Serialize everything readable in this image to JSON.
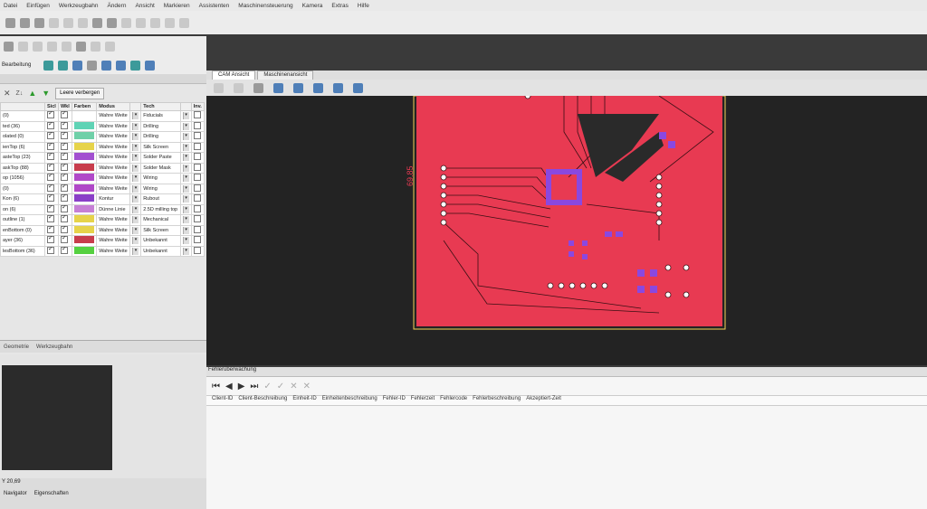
{
  "menu": [
    "Datei",
    "Einfügen",
    "Werkzeugbahn",
    "Ändern",
    "Ansicht",
    "Markieren",
    "Assistenten",
    "Maschinensteuerung",
    "Kamera",
    "Extras",
    "Hilfe"
  ],
  "toolbar": {
    "label_bearbeitung": "Bearbeitung"
  },
  "layers_panel": {
    "hide_button": "Leere verbergen",
    "columns": [
      "",
      "Sicl",
      "Wkl",
      "Farben",
      "Modus",
      "",
      "Tech",
      "",
      "Inv."
    ],
    "rows": [
      {
        "name": "(0)",
        "color": "#ffffff",
        "mode": "Wahre Weite",
        "tech": "Fiducials"
      },
      {
        "name": "ted (36)",
        "color": "#5fd3b5",
        "mode": "Wahre Weite",
        "tech": "Drilling"
      },
      {
        "name": "olated (0)",
        "color": "#6fd0a8",
        "mode": "Wahre Weite",
        "tech": "Drilling"
      },
      {
        "name": "ienTop (6)",
        "color": "#e6d34a",
        "mode": "Wahre Weite",
        "tech": "Silk Screen"
      },
      {
        "name": "asteTop (23)",
        "color": "#a24fd0",
        "mode": "Wahre Weite",
        "tech": "Solder Paste"
      },
      {
        "name": "askTop (88)",
        "color": "#c83c4c",
        "mode": "Wahre Weite",
        "tech": "Solder Mask"
      },
      {
        "name": "op (1056)",
        "color": "#b048c8",
        "mode": "Wahre Weite",
        "tech": "Wiring"
      },
      {
        "name": "(0)",
        "color": "#b048c8",
        "mode": "Wahre Weite",
        "tech": "Wiring"
      },
      {
        "name": "Kon (6)",
        "color": "#8a3fc8",
        "mode": "Kontur",
        "tech": "Rubout"
      },
      {
        "name": "on (6)",
        "color": "#c67fd6",
        "mode": "Dünne Linie",
        "tech": "2.5D milling top"
      },
      {
        "name": "outline (1)",
        "color": "#e6d34a",
        "mode": "Wahre Weite",
        "tech": "Mechanical"
      },
      {
        "name": "enBottom (0)",
        "color": "#e6d34a",
        "mode": "Wahre Weite",
        "tech": "Silk Screen"
      },
      {
        "name": "ayer (36)",
        "color": "#c83c4c",
        "mode": "Wahre Weite",
        "tech": "Unbekannt"
      },
      {
        "name": "lesBottom (36)",
        "color": "#55d040",
        "mode": "Wahre Weite",
        "tech": "Unbekannt"
      }
    ]
  },
  "bottom_tabs": [
    "Geometrie",
    "Werkzeugbahn"
  ],
  "status_left": {
    "coord": "Y 20,69",
    "tab1": "Navigator",
    "tab2": "Eigenschaften"
  },
  "cam": {
    "tabs": [
      "CAM Ansicht",
      "Maschinenansicht"
    ],
    "dimension_label": "69,85"
  },
  "error_panel": {
    "title": "Fehlerüberwachung",
    "columns": [
      "Client-ID",
      "Client-Beschreibung",
      "Einheit-ID",
      "Einheitenbeschreibung",
      "Fehler-ID",
      "Fehlerzeit",
      "Fehlercode",
      "Fehlerbeschreibung",
      "Akzeptiert-Zeit"
    ]
  },
  "colors": {
    "board": "#e83a52",
    "board_edge": "#f5d35a",
    "pad": "#8a48e0"
  }
}
